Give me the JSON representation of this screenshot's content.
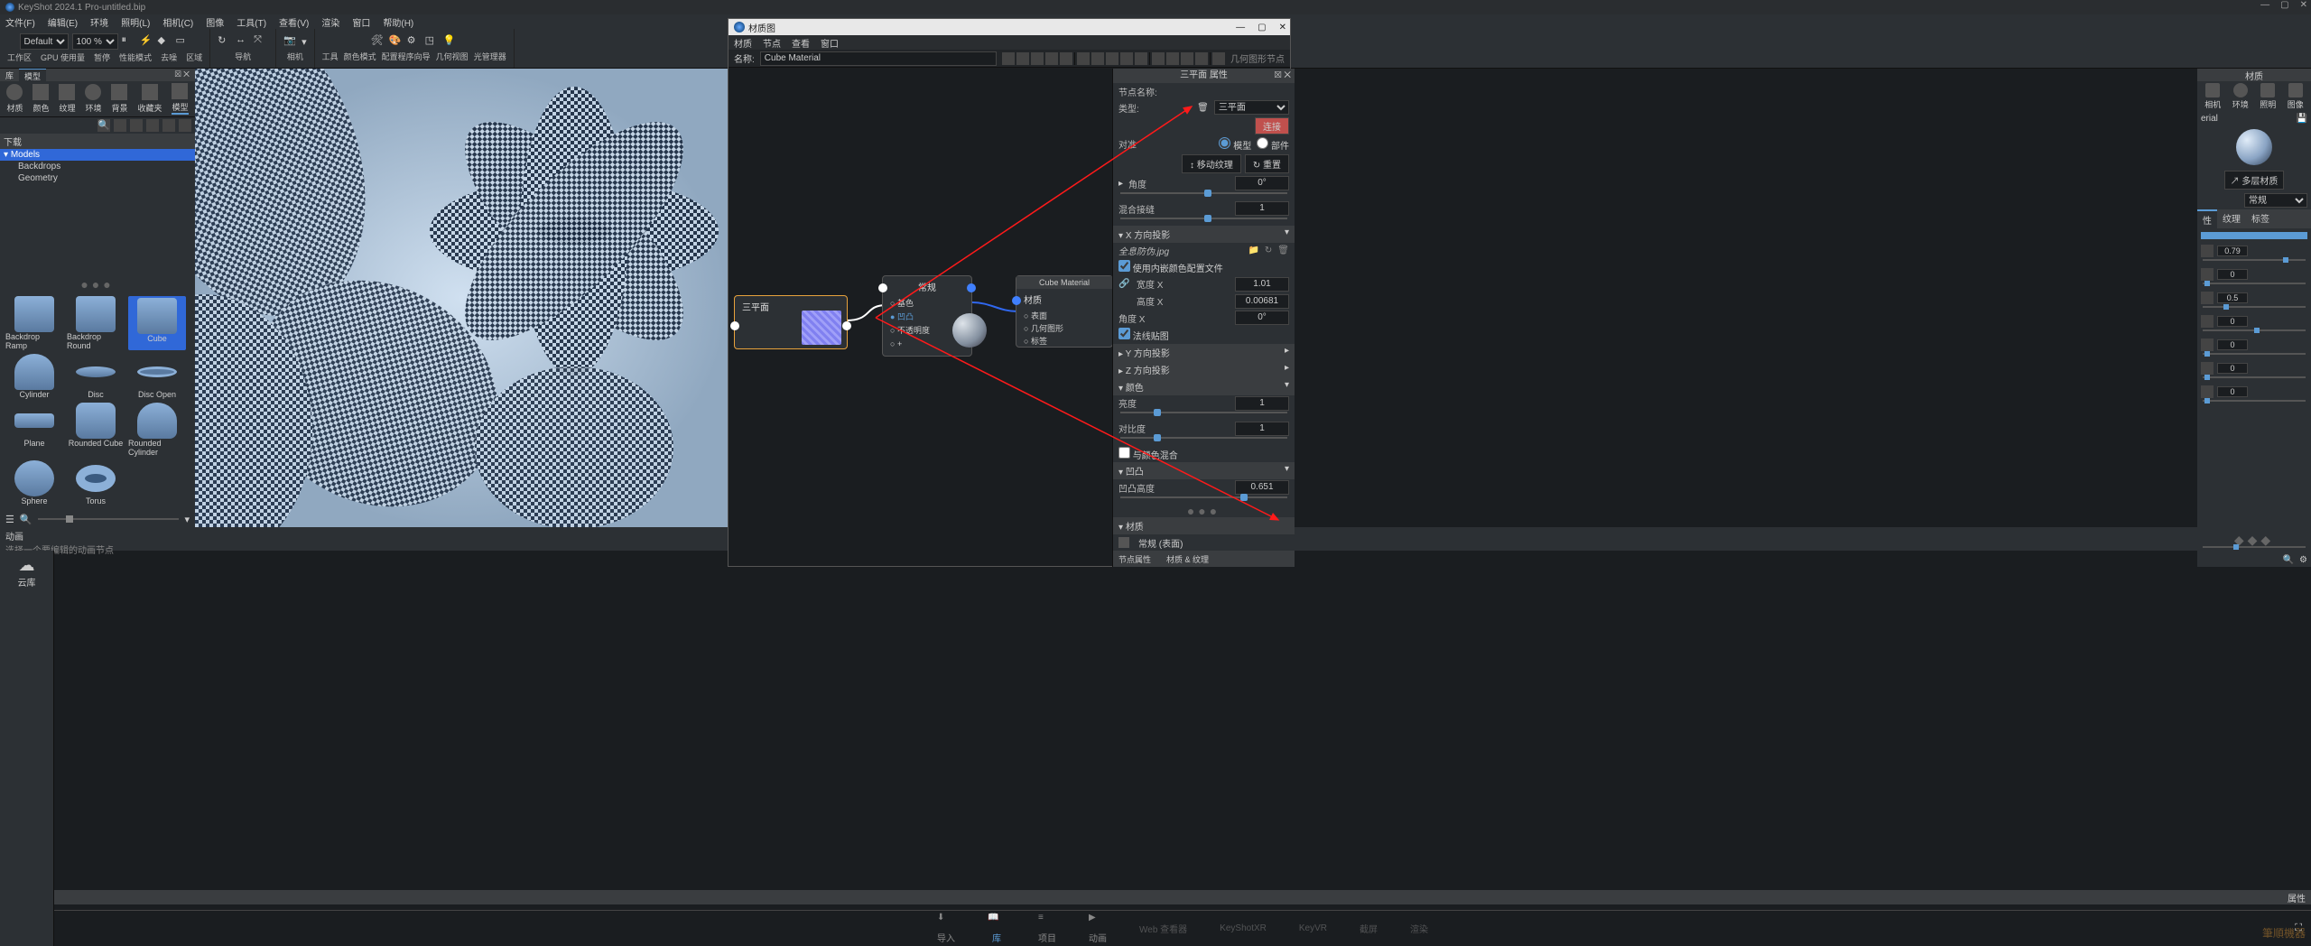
{
  "app_title": "KeyShot 2024.1 Pro",
  "doc_title": "untitled.bip",
  "file_sep": " - ",
  "menus": [
    "文件(F)",
    "编辑(E)",
    "环境",
    "照明(L)",
    "相机(C)",
    "图像",
    "工具(T)",
    "查看(V)",
    "渲染",
    "窗口",
    "帮助(H)"
  ],
  "toolbar": {
    "preset": "Default",
    "zoom": "100 %",
    "labels": {
      "workspace": "工作区",
      "gpu": "GPU 使用量",
      "pause": "暂停",
      "perf": "性能模式",
      "denoise": "去噪",
      "region": "区域",
      "nav": "导航",
      "cam": "相机",
      "tools": "工具",
      "colormode": "颜色模式",
      "program": "配置程序向导",
      "geomview": "几何视图",
      "lightmgr": "光管理器"
    }
  },
  "leftpanel": {
    "tabs": [
      "库",
      "模型"
    ],
    "icon_tabs": [
      "材质",
      "颜色",
      "纹理",
      "环境",
      "背景",
      "收藏夹",
      "模型"
    ],
    "tree": {
      "hdr": "下载",
      "root": "Models",
      "children": [
        "Backdrops",
        "Geometry"
      ]
    },
    "thumbs": [
      "Backdrop Ramp",
      "Backdrop Round",
      "Cube",
      "Cylinder",
      "Disc",
      "Disc Open",
      "Plane",
      "Rounded Cube",
      "Rounded Cylinder",
      "Sphere",
      "Torus"
    ],
    "selected_thumb": "Cube"
  },
  "viewport": {
    "right_label": "属性"
  },
  "anim": {
    "title": "动画",
    "hint": "选择一个要编辑的动画节点"
  },
  "cloud": "云库",
  "bottombar": [
    "导入",
    "库",
    "项目",
    "动画",
    "Web 查看器",
    "KeyShotXR",
    "KeyVR",
    "截屏",
    "渲染"
  ],
  "bottombar_active": 1,
  "matwin": {
    "title": "材质图",
    "menus": [
      "材质",
      "节点",
      "查看",
      "窗口"
    ],
    "name_lbl": "名称:",
    "name": "Cube Material",
    "geom_node_lbl": "几何图形节点",
    "nodes": {
      "triplanar": "三平面",
      "normal": "常规",
      "material": "材质",
      "cube": "Cube Material",
      "pins_normal": [
        "基色",
        "凹凸",
        "不透明度",
        "+"
      ],
      "pins_material": [
        "表面",
        "几何图形",
        "标签"
      ]
    }
  },
  "props": {
    "title": "三平面 属性",
    "node_name_lbl": "节点名称:",
    "type_lbl": "类型:",
    "type_val": "三平面",
    "link": "连接",
    "align": "对准",
    "align_model": "模型",
    "align_part": "部件",
    "move_tex": "移动纹理",
    "reset": "重置",
    "angle": "角度",
    "angle_val": "0°",
    "blend": "混合接缝",
    "blend_val": "1",
    "xproj": "X 方向投影",
    "texfile": "全息防伪.jpg",
    "embed": "使用内嵌颜色配置文件",
    "widthx": "宽度 X",
    "widthx_val": "1.01",
    "heightx": "高度 X",
    "heightx_val": "0.00681",
    "anglex": "角度 X",
    "anglex_val": "0°",
    "normalmap": "法线贴图",
    "yproj": "Y 方向投影",
    "zproj": "Z 方向投影",
    "color": "颜色",
    "brightness": "亮度",
    "brightness_val": "1",
    "contrast": "对比度",
    "contrast_val": "1",
    "blendcolor": "与颜色混合",
    "bump": "凹凸",
    "bumph": "凹凸高度",
    "bumph_val": "0.651",
    "mat": "材质",
    "mat_item": "常规 (表面)",
    "nodeprops": "节点属性",
    "mattex": "材质 & 纹理"
  },
  "farpanel": {
    "title": "材质",
    "tabs": [
      "相机",
      "环境",
      "照明",
      "图像"
    ],
    "mat_name": "erial",
    "multi": "多层材质",
    "type": "常规",
    "subtabs": [
      "性",
      "纹理",
      "标签"
    ],
    "opacity": "0.79",
    "val_0": "0",
    "val_05": "0.5"
  }
}
